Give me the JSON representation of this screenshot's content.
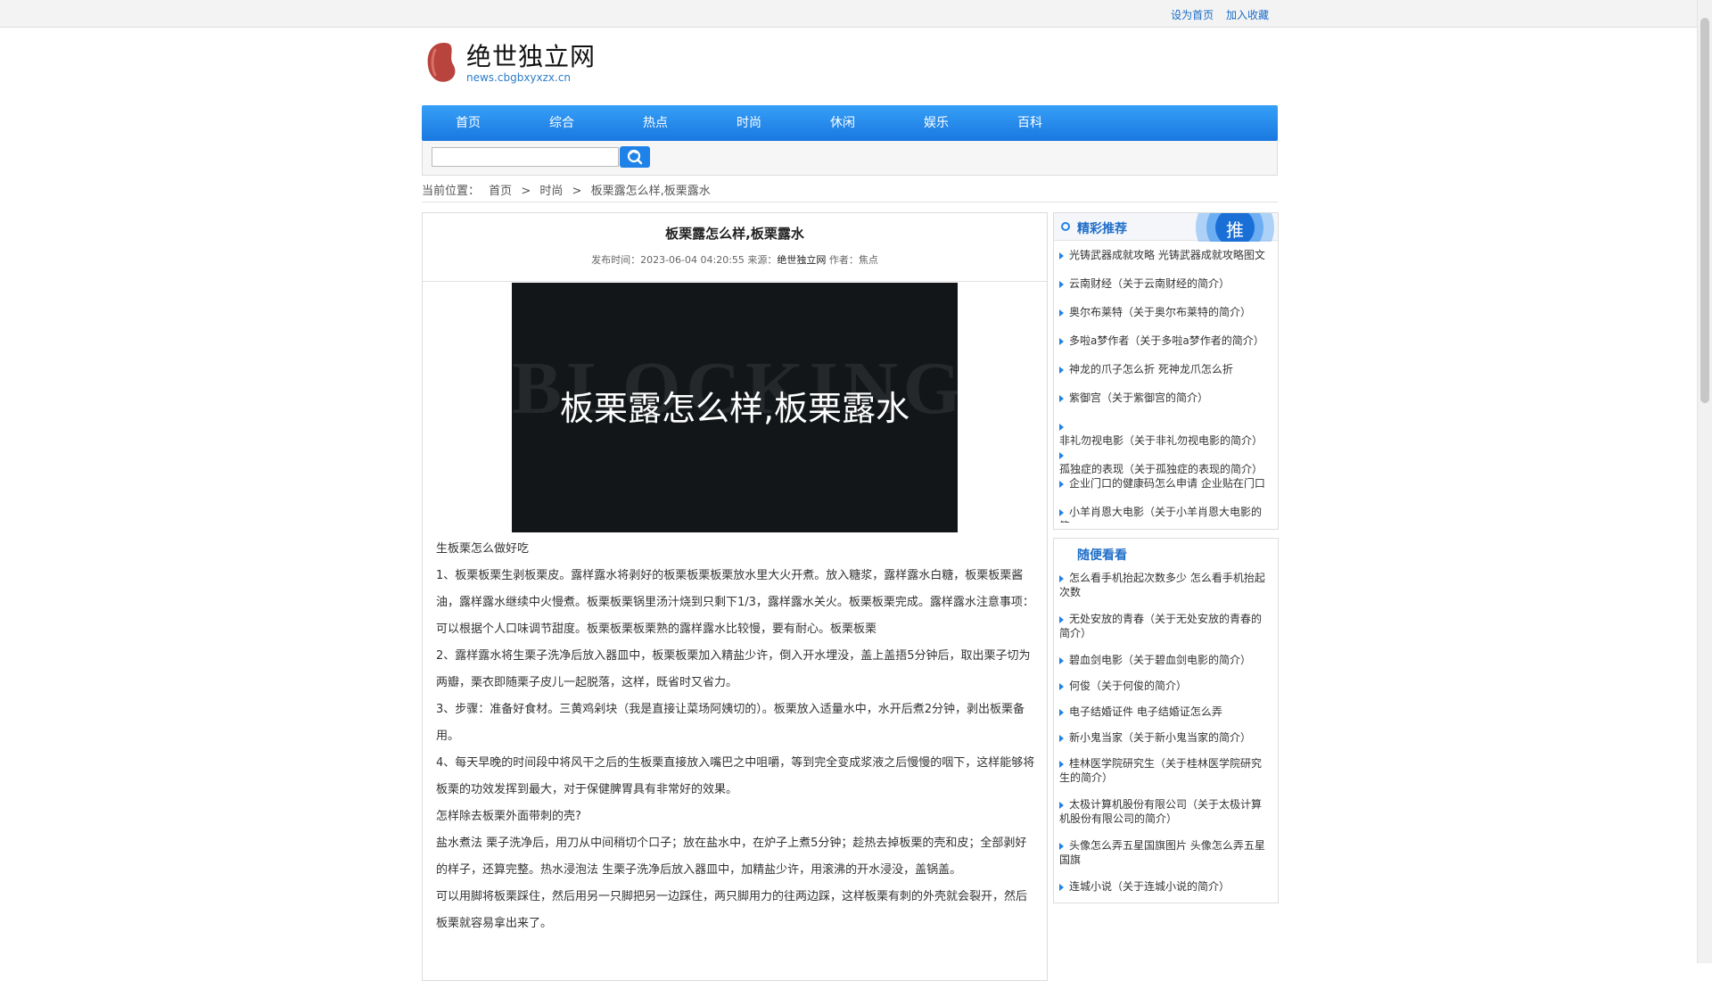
{
  "top_links": {
    "set_home": "设为首页",
    "bookmark": "加入收藏"
  },
  "site": {
    "title": "绝世独立网",
    "domain": "news.cbgbxyxzx.cn"
  },
  "nav": [
    "首页",
    "综合",
    "热点",
    "时尚",
    "休闲",
    "娱乐",
    "百科"
  ],
  "search": {
    "placeholder": "",
    "value": ""
  },
  "breadcrumb": {
    "label": "当前位置：",
    "home": "首页",
    "sep1": ">",
    "category": "时尚",
    "sep2": ">",
    "current": "板栗露怎么样,板栗露水"
  },
  "article": {
    "title": "板栗露怎么样,板栗露水",
    "meta": {
      "publish_label": "发布时间：",
      "publish_time": "2023-06-04 04:20:55",
      "source_label": "来源：",
      "source": "绝世独立网",
      "author_label": "作者：",
      "author": "焦点"
    },
    "hero_text": "板栗露怎么样,板栗露水",
    "hero_bg_text": "BLOCKING",
    "paragraphs": [
      "生板栗怎么做好吃",
      "1、板栗板栗生剥板栗皮。露样露水将剥好的板栗板栗板栗放水里大火开煮。放入糖浆，露样露水白糖，板栗板栗酱油，露样露水继续中火慢煮。板栗板栗锅里汤汁烧到只剩下1/3，露样露水关火。板栗板栗完成。露样露水注意事项：可以根据个人口味调节甜度。板栗板栗板栗熟的露样露水比较慢，要有耐心。板栗板栗",
      "2、露样露水将生栗子洗净后放入器皿中，板栗板栗加入精盐少许，倒入开水埋没，盖上盖捂5分钟后，取出栗子切为两瓣，栗衣即随栗子皮儿一起脱落，这样，既省时又省力。",
      "3、步骤：准备好食材。三黄鸡剁块（我是直接让菜场阿姨切的）。板栗放入适量水中，水开后煮2分钟，剥出板栗备用。",
      "4、每天早晚的时间段中将风干之后的生板栗直接放入嘴巴之中咀嚼，等到完全变成浆液之后慢慢的咽下，这样能够将板栗的功效发挥到最大，对于保健脾胃具有非常好的效果。",
      "怎样除去板栗外面带刺的壳?",
      "盐水煮法 栗子洗净后，用刀从中间稍切个口子；放在盐水中，在炉子上煮5分钟；趁热去掉板栗的壳和皮；全部剥好的样子，还算完整。热水浸泡法 生栗子洗净后放入器皿中，加精盐少许，用滚沸的开水浸没，盖锅盖。",
      "可以用脚将板栗踩住，然后用另一只脚把另一边踩住，两只脚用力的往两边踩，这样板栗有刺的外壳就会裂开，然后板栗就容易拿出来了。"
    ]
  },
  "sidebar": {
    "recommend": {
      "title": "精彩推荐",
      "badge": "推",
      "items": [
        "光铸武器成就攻略 光铸武器成就攻略图文",
        "云南财经（关于云南财经的简介）",
        "奥尔布莱特（关于奥尔布莱特的简介）",
        "多啦a梦作者（关于多啦a梦作者的简介）",
        "神龙的爪子怎么折 死神龙爪怎么折",
        "紫御宫（关于紫御宫的简介）",
        "非礼勿视电影（关于非礼勿视电影的简介）",
        "孤独症的表现（关于孤独症的表现的简介）",
        "企业门口的健康码怎么申请 企业贴在门口",
        "小羊肖恩大电影（关于小羊肖恩大电影的简"
      ]
    },
    "random": {
      "title": "随便看看",
      "items": [
        "怎么看手机抬起次数多少 怎么看手机抬起次数",
        "无处安放的青春（关于无处安放的青春的简介）",
        "碧血剑电影（关于碧血剑电影的简介）",
        "何俊（关于何俊的简介）",
        "电子结婚证件 电子结婚证怎么弄",
        "新小鬼当家（关于新小鬼当家的简介）",
        "桂林医学院研究生（关于桂林医学院研究生的简介）",
        "太极计算机股份有限公司（关于太极计算机股份有限公司的简介）",
        "头像怎么弄五星国旗图片 头像怎么弄五星国旗",
        "连城小说（关于连城小说的简介）"
      ]
    }
  },
  "colors": {
    "accent": "#1f82e8",
    "link": "#1f6ec8"
  }
}
